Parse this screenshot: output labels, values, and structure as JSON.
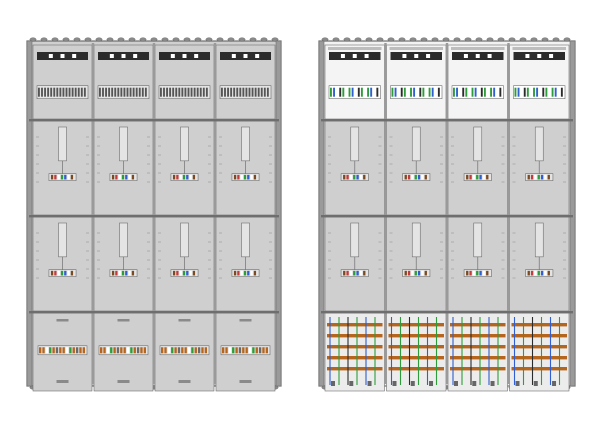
{
  "figure": {
    "views": [
      {
        "id": "closed-view",
        "kind": "covered",
        "columns": 4
      },
      {
        "id": "open-view",
        "kind": "open",
        "columns": 4
      }
    ],
    "colors": {
      "background": "#ffffff",
      "frame": "#9a9a9a",
      "frame_dark": "#6e6e6e",
      "panel": "#cfcfcf",
      "panel_light": "#e4e4e4",
      "bar_dark": "#2b2b2b",
      "copper": "#b5651d",
      "green": "#2e9c3a",
      "blue": "#2f5fd0",
      "brown": "#7a4a22",
      "red": "#c43b3b",
      "white": "#ffffff"
    }
  }
}
